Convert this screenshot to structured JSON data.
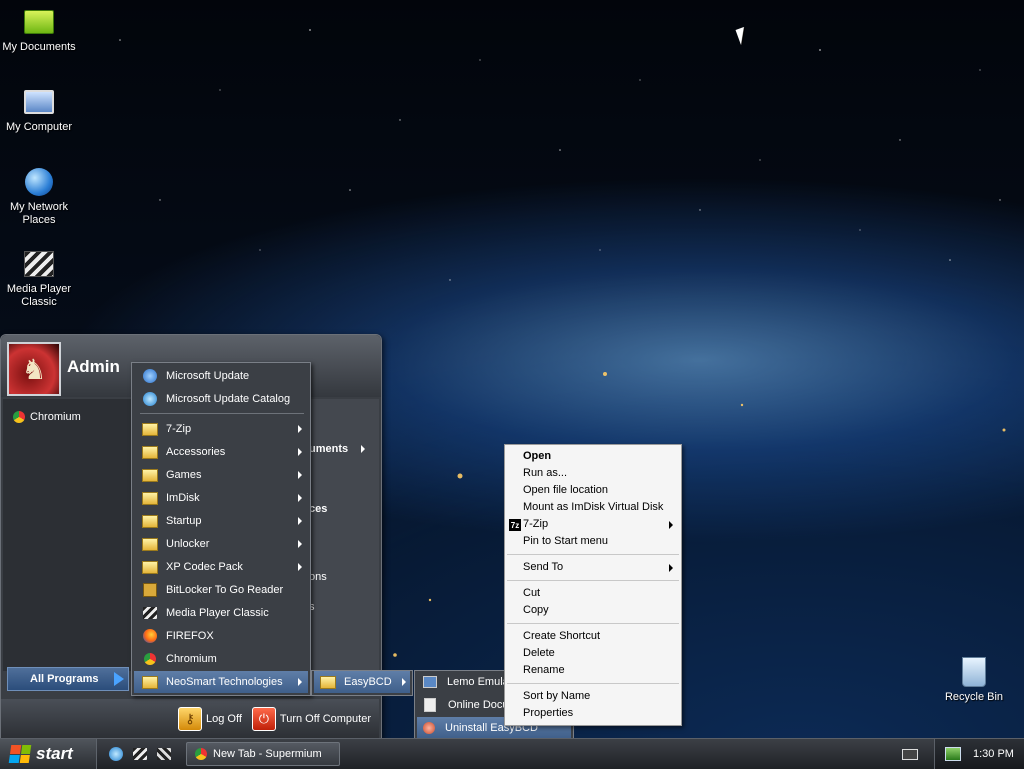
{
  "desktop": {
    "icons": [
      {
        "label": "My Documents",
        "icon": "folder-documents-icon"
      },
      {
        "label": "My Computer",
        "icon": "computer-icon"
      },
      {
        "label": "My Network Places",
        "icon": "network-globe-icon"
      },
      {
        "label": "Media Player Classic",
        "icon": "media-player-icon"
      },
      {
        "label": "Recycle Bin",
        "icon": "recycle-bin-icon"
      }
    ]
  },
  "start_menu": {
    "username": "Admin",
    "pinned": [
      {
        "label": "Chromium",
        "icon": "chromium-icon"
      }
    ],
    "right_pane_fragments": [
      "uments",
      "ces",
      "ons",
      "s"
    ],
    "all_programs_label": "All Programs",
    "log_off_label": "Log Off",
    "turn_off_label": "Turn Off Computer"
  },
  "programs_menu": {
    "items": [
      {
        "label": "Microsoft Update",
        "icon": "windows-update-icon",
        "submenu": false
      },
      {
        "label": "Microsoft Update Catalog",
        "icon": "ie-icon",
        "submenu": false
      },
      {
        "label": "7-Zip",
        "icon": "folder-icon",
        "submenu": true
      },
      {
        "label": "Accessories",
        "icon": "folder-icon",
        "submenu": true
      },
      {
        "label": "Games",
        "icon": "folder-icon",
        "submenu": true
      },
      {
        "label": "ImDisk",
        "icon": "folder-icon",
        "submenu": true
      },
      {
        "label": "Startup",
        "icon": "folder-icon",
        "submenu": true
      },
      {
        "label": "Unlocker",
        "icon": "folder-icon",
        "submenu": true
      },
      {
        "label": "XP Codec Pack",
        "icon": "folder-icon",
        "submenu": true
      },
      {
        "label": "BitLocker To Go Reader",
        "icon": "bitlocker-icon",
        "submenu": false
      },
      {
        "label": "Media Player Classic",
        "icon": "media-player-icon",
        "submenu": false
      },
      {
        "label": "FIREFOX",
        "icon": "firefox-icon",
        "submenu": false
      },
      {
        "label": "Chromium",
        "icon": "chromium-icon",
        "submenu": false
      },
      {
        "label": "NeoSmart Technologies",
        "icon": "folder-icon",
        "submenu": true
      }
    ]
  },
  "neosmart_menu": {
    "items": [
      {
        "label": "EasyBCD",
        "icon": "folder-icon",
        "submenu": true
      }
    ]
  },
  "easybcd_menu": {
    "items": [
      {
        "label": "Lemo Emulat",
        "icon": "monitor-icon"
      },
      {
        "label": "Online Docu",
        "icon": "document-icon"
      },
      {
        "label": "Uninstall EasyBCD",
        "icon": "uninstall-icon"
      }
    ]
  },
  "context_menu": {
    "items": [
      {
        "label": "Open",
        "bold": true
      },
      {
        "label": "Run as..."
      },
      {
        "label": "Open file location"
      },
      {
        "label": "Mount as ImDisk Virtual Disk"
      },
      {
        "label": "7-Zip",
        "submenu": true,
        "badge": "7z"
      },
      {
        "label": "Pin to Start menu"
      },
      {
        "label": "Send To",
        "submenu": true
      },
      {
        "label": "Cut"
      },
      {
        "label": "Copy"
      },
      {
        "label": "Create Shortcut"
      },
      {
        "label": "Delete"
      },
      {
        "label": "Rename"
      },
      {
        "label": "Sort by Name"
      },
      {
        "label": "Properties"
      }
    ]
  },
  "taskbar": {
    "start_label": "start",
    "window_title": "New Tab - Supermium",
    "clock": "1:30 PM"
  }
}
